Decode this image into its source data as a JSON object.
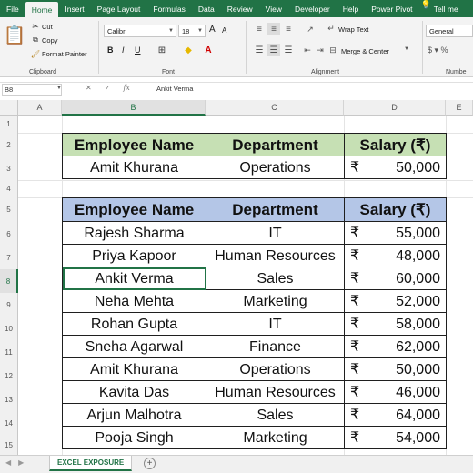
{
  "ribbon_tabs": [
    "File",
    "Home",
    "Insert",
    "Page Layout",
    "Formulas",
    "Data",
    "Review",
    "View",
    "Developer",
    "Help",
    "Power Pivot",
    "Tell me"
  ],
  "active_tab": "Home",
  "clipboard": {
    "cut": "Cut",
    "copy": "Copy",
    "format_painter": "Format Painter",
    "label": "Clipboard"
  },
  "font": {
    "name": "Calibri",
    "size": "18",
    "label": "Font",
    "bold": "B",
    "italic": "I",
    "underline": "U",
    "grow": "A",
    "shrink": "A"
  },
  "alignment": {
    "wrap_text": "Wrap Text",
    "merge_center": "Merge & Center",
    "label": "Alignment"
  },
  "number": {
    "format": "General",
    "label": "Numbe"
  },
  "formula_bar": {
    "name_box": "B8",
    "content": "Ankit Verma",
    "fx": "fx"
  },
  "columns": [
    "A",
    "B",
    "C",
    "D",
    "E"
  ],
  "rows": [
    "1",
    "2",
    "3",
    "4",
    "5",
    "6",
    "7",
    "8",
    "9",
    "10",
    "11",
    "12",
    "13",
    "14",
    "15"
  ],
  "lookup_table": {
    "headers": [
      "Employee Name",
      "Department",
      "Salary (₹)"
    ],
    "row": {
      "name": "Amit Khurana",
      "department": "Operations",
      "currency": "₹",
      "salary": "50,000"
    }
  },
  "main_table": {
    "headers": [
      "Employee Name",
      "Department",
      "Salary (₹)"
    ],
    "rows": [
      {
        "name": "Rajesh Sharma",
        "department": "IT",
        "currency": "₹",
        "salary": "55,000"
      },
      {
        "name": "Priya Kapoor",
        "department": "Human Resources",
        "currency": "₹",
        "salary": "48,000"
      },
      {
        "name": "Ankit Verma",
        "department": "Sales",
        "currency": "₹",
        "salary": "60,000"
      },
      {
        "name": "Neha Mehta",
        "department": "Marketing",
        "currency": "₹",
        "salary": "52,000"
      },
      {
        "name": "Rohan Gupta",
        "department": "IT",
        "currency": "₹",
        "salary": "58,000"
      },
      {
        "name": "Sneha Agarwal",
        "department": "Finance",
        "currency": "₹",
        "salary": "62,000"
      },
      {
        "name": "Amit Khurana",
        "department": "Operations",
        "currency": "₹",
        "salary": "50,000"
      },
      {
        "name": "Kavita Das",
        "department": "Human Resources",
        "currency": "₹",
        "salary": "46,000"
      },
      {
        "name": "Arjun Malhotra",
        "department": "Sales",
        "currency": "₹",
        "salary": "64,000"
      },
      {
        "name": "Pooja Singh",
        "department": "Marketing",
        "currency": "₹",
        "salary": "54,000"
      }
    ]
  },
  "sheet_tab": "EXCEL EXPOSURE",
  "add_sheet": "+",
  "colors": {
    "excel_green": "#217346",
    "lookup_header": "#c6e0b4",
    "main_header": "#b4c6e7"
  }
}
